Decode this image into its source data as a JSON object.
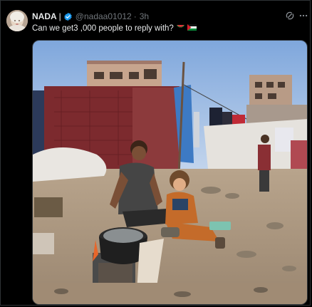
{
  "tweet": {
    "author_name": "NADA",
    "author_separator": "|",
    "handle": "@nadaa01012",
    "dot": "·",
    "time": "3h",
    "text": "Can we get3 ,000 people to reply with?"
  },
  "icons": {
    "avatar": "avatar-photo",
    "verified": "verified-badge-icon",
    "grok": "grok-icon",
    "more": "more-icon",
    "watermelon": "watermelon-emoji-icon",
    "flag": "palestine-flag-emoji-icon"
  },
  "media": {
    "kind": "photo"
  },
  "colors": {
    "background": "#000000",
    "text": "#e7e9ea",
    "muted": "#71767b",
    "verified": "#1d9bf0",
    "border": "#2f3336"
  }
}
